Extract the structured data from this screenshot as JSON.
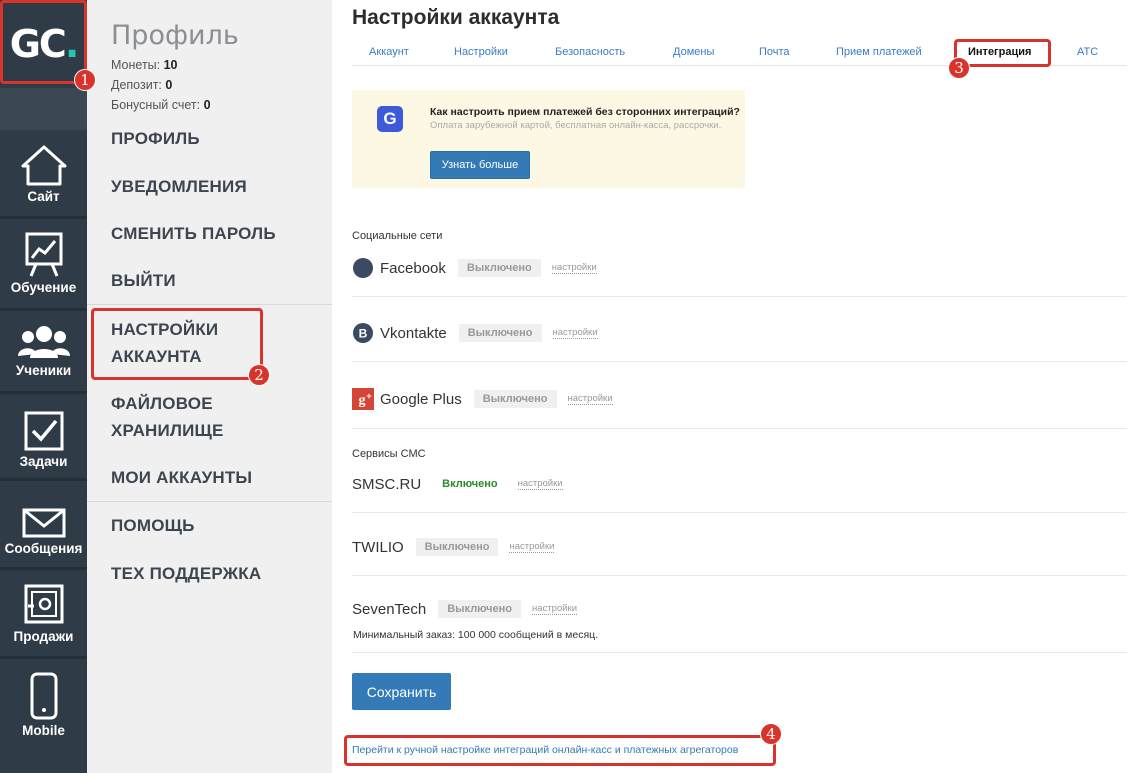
{
  "rail": {
    "logo": {
      "text": "GC",
      "dot": "."
    },
    "items": [
      {
        "label": "Сайт",
        "icon": "house-icon"
      },
      {
        "label": "Обучение",
        "icon": "chart-board-icon"
      },
      {
        "label": "Ученики",
        "icon": "users-icon"
      },
      {
        "label": "Задачи",
        "icon": "checkbox-icon"
      },
      {
        "label": "Сообщения",
        "icon": "envelope-icon"
      },
      {
        "label": "Продажи",
        "icon": "safe-icon"
      },
      {
        "label": "Mobile",
        "icon": "phone-icon"
      }
    ]
  },
  "submenu": {
    "title": "Профиль",
    "stats": [
      {
        "label": "Монеты: ",
        "value": "10"
      },
      {
        "label": "Депозит: ",
        "value": "0"
      },
      {
        "label": "Бонусный счет: ",
        "value": "0"
      }
    ],
    "links": [
      "ПРОФИЛЬ",
      "УВЕДОМЛЕНИЯ",
      "СМЕНИТЬ ПАРОЛЬ",
      "ВЫЙТИ"
    ],
    "account_links": [
      "НАСТРОЙКИ АККАУНТА",
      "ФАЙЛОВОЕ ХРАНИЛИЩЕ",
      "МОИ АККАУНТЫ"
    ],
    "account_settings_line1": "НАСТРОЙКИ",
    "account_settings_line2": "АККАУНТА",
    "file_storage_line1": "ФАЙЛОВОЕ",
    "file_storage_line2": "ХРАНИЛИЩЕ",
    "my_accounts": "МОИ АККАУНТЫ",
    "help_links": [
      "ПОМОЩЬ",
      "ТЕХ ПОДДЕРЖКА"
    ]
  },
  "main": {
    "title": "Настройки аккаунта",
    "tabs": [
      {
        "label": "Аккаунт"
      },
      {
        "label": "Настройки"
      },
      {
        "label": "Безопасность"
      },
      {
        "label": "Домены"
      },
      {
        "label": "Почта"
      },
      {
        "label": "Прием платежей"
      },
      {
        "label": "Интеграция",
        "active": true
      },
      {
        "label": "АТС"
      }
    ],
    "promo": {
      "icon_letter": "G",
      "title": "Как настроить прием платежей без сторонних интеграций?",
      "subtitle": "Оплата зарубежной картой, бесплатная онлайн-касса, рассрочки.",
      "button": "Узнать больше"
    },
    "social_label": "Социальные сети",
    "sms_label": "Сервисы СМС",
    "settings_link": "настройки",
    "integrations": [
      {
        "name": "Facebook",
        "status": "Выключено",
        "on": false,
        "icon": "facebook-icon"
      },
      {
        "name": "Vkontakte",
        "status": "Выключено",
        "on": false,
        "icon": "vk-icon"
      },
      {
        "name": "Google Plus",
        "status": "Выключено",
        "on": false,
        "icon": "google-plus-icon"
      },
      {
        "name": "SMSC.RU",
        "status": "Включено",
        "on": true
      },
      {
        "name": "TWILIO",
        "status": "Выключено",
        "on": false
      },
      {
        "name": "SevenTech",
        "status": "Выключено",
        "on": false
      }
    ],
    "seventech_note": "Минимальный заказ: 100 000 сообщений в месяц.",
    "save_button": "Сохранить",
    "manual_link": "Перейти к ручной настройке интеграций онлайн-касс и платежных агрегаторов"
  },
  "annotations": [
    "1",
    "2",
    "3",
    "4"
  ],
  "colors": {
    "rail": "#2f3b47",
    "accent": "#337ab7",
    "annotation": "#d9342b",
    "teal": "#27c4b3"
  }
}
